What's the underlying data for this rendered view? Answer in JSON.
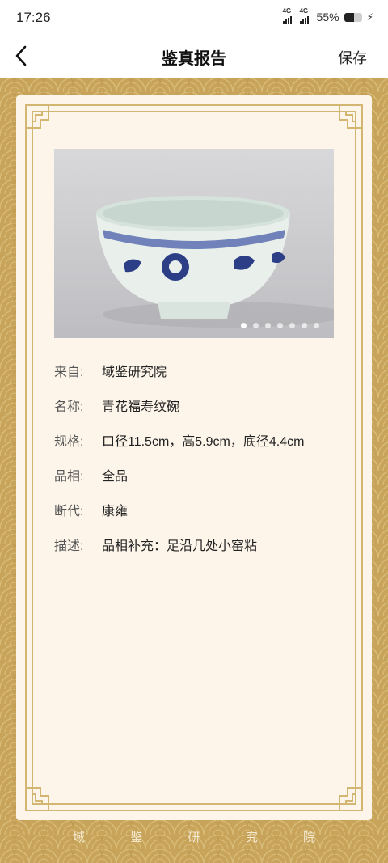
{
  "status": {
    "time": "17:26",
    "network1": "4G",
    "network2": "4G+",
    "battery_text": "55%",
    "battery_level": 0.55
  },
  "header": {
    "title": "鉴真报告",
    "save_label": "保存"
  },
  "gallery": {
    "image_count": 7,
    "active_index": 0
  },
  "details": [
    {
      "label": "来自:",
      "value": "域鉴研究院"
    },
    {
      "label": "名称:",
      "value": "青花福寿纹碗"
    },
    {
      "label": "规格:",
      "value": "口径11.5cm，高5.9cm，底径4.4cm"
    },
    {
      "label": "品相:",
      "value": "全品"
    },
    {
      "label": "断代:",
      "value": "康雍"
    },
    {
      "label": "描述:",
      "value": "品相补充：足沿几处小窑粘"
    }
  ],
  "footer": [
    "域",
    "鉴",
    "研",
    "究",
    "院"
  ],
  "colors": {
    "frame_gold": "#c8a45a",
    "card_bg": "#fdf5ea",
    "ornament": "#d4b673",
    "porcelain_blue": "#2c3f86"
  }
}
